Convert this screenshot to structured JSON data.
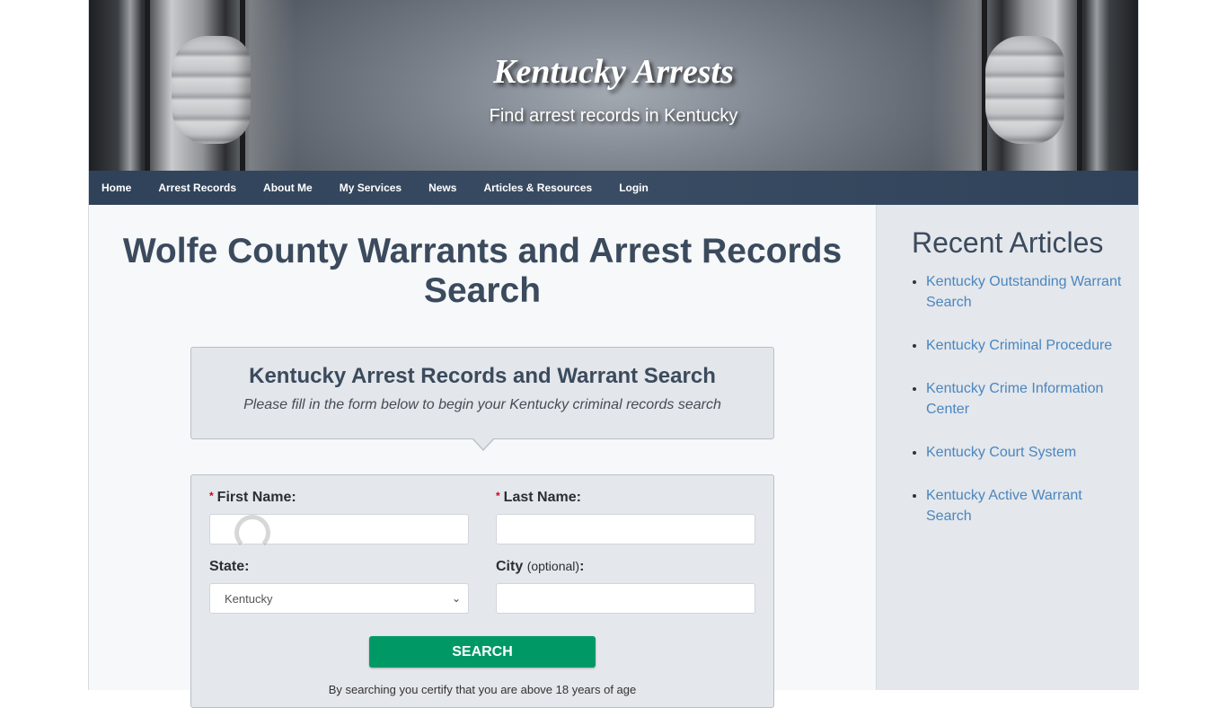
{
  "header": {
    "site_title": "Kentucky Arrests",
    "tagline": "Find arrest records in Kentucky"
  },
  "nav": {
    "items": [
      {
        "label": "Home"
      },
      {
        "label": "Arrest Records"
      },
      {
        "label": "About Me"
      },
      {
        "label": "My Services"
      },
      {
        "label": "News"
      },
      {
        "label": "Articles & Resources"
      },
      {
        "label": "Login"
      }
    ]
  },
  "main": {
    "page_title": "Wolfe County Warrants and Arrest Records Search",
    "callout": {
      "title": "Kentucky Arrest Records and Warrant Search",
      "subtitle": "Please fill in the form below to begin your Kentucky criminal records search"
    },
    "form": {
      "required_marker": "*",
      "first_name_label": "First Name:",
      "first_name_value": "",
      "last_name_label": "Last Name:",
      "last_name_value": "",
      "state_label": "State:",
      "state_selected": "Kentucky",
      "city_label": "City",
      "city_optional": "(optional)",
      "city_colon": ":",
      "city_value": "",
      "search_button": "SEARCH",
      "certification_text": "By searching you certify that you are above 18 years of age"
    }
  },
  "sidebar": {
    "title": "Recent Articles",
    "articles": [
      {
        "label": "Kentucky Outstanding Warrant Search"
      },
      {
        "label": "Kentucky Criminal Procedure"
      },
      {
        "label": "Kentucky Crime Information Center"
      },
      {
        "label": "Kentucky Court System"
      },
      {
        "label": "Kentucky Active Warrant Search"
      }
    ]
  },
  "colors": {
    "nav_bg": "#34475e",
    "heading": "#3b4a5d",
    "link": "#4a86c0",
    "search_button": "#009966",
    "required": "#d0021b"
  }
}
